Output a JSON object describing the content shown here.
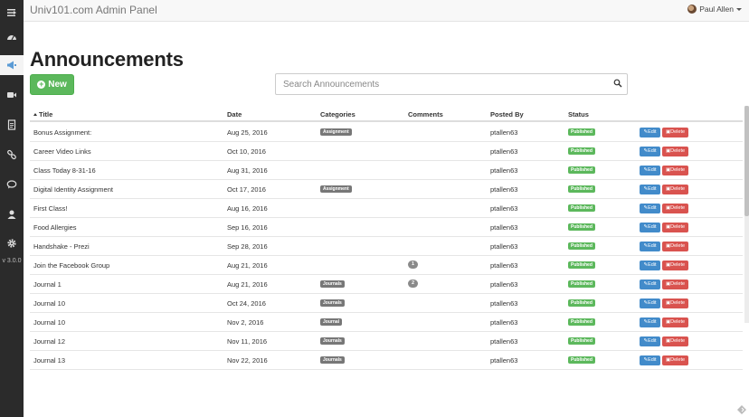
{
  "app": {
    "brand": "Univ101.com Admin Panel",
    "user_name": "Paul Allen"
  },
  "sidebar": {
    "items": [
      {
        "name": "menu-toggle-icon"
      },
      {
        "name": "dashboard-icon"
      },
      {
        "name": "announcements-icon",
        "active": true
      },
      {
        "name": "video-icon"
      },
      {
        "name": "document-icon"
      },
      {
        "name": "link-icon"
      },
      {
        "name": "chat-icon"
      },
      {
        "name": "user-icon"
      },
      {
        "name": "gear-icon"
      }
    ],
    "version": "v 3.0.0"
  },
  "page": {
    "title": "Announcements",
    "new_button_label": "New"
  },
  "search": {
    "placeholder": "Search Announcements",
    "value": ""
  },
  "table": {
    "columns": [
      "Title",
      "Date",
      "Categories",
      "Comments",
      "Posted By",
      "Status"
    ],
    "rows": [
      {
        "title": "Bonus Assignment:",
        "date": "Aug 25, 2016",
        "category": "Assignment",
        "comments": "",
        "posted_by": "ptallen63",
        "status": "Published"
      },
      {
        "title": "Career Video Links",
        "date": "Oct 10, 2016",
        "category": "",
        "comments": "",
        "posted_by": "ptallen63",
        "status": "Published"
      },
      {
        "title": "Class Today 8-31-16",
        "date": "Aug 31, 2016",
        "category": "",
        "comments": "",
        "posted_by": "ptallen63",
        "status": "Published"
      },
      {
        "title": "Digital Identity Assignment",
        "date": "Oct 17, 2016",
        "category": "Assignment",
        "comments": "",
        "posted_by": "ptallen63",
        "status": "Published"
      },
      {
        "title": "First Class!",
        "date": "Aug 16, 2016",
        "category": "",
        "comments": "",
        "posted_by": "ptallen63",
        "status": "Published"
      },
      {
        "title": "Food Allergies",
        "date": "Sep 16, 2016",
        "category": "",
        "comments": "",
        "posted_by": "ptallen63",
        "status": "Published"
      },
      {
        "title": "Handshake - Prezi",
        "date": "Sep 28, 2016",
        "category": "",
        "comments": "",
        "posted_by": "ptallen63",
        "status": "Published"
      },
      {
        "title": "Join the Facebook Group",
        "date": "Aug 21, 2016",
        "category": "",
        "comments": "1",
        "posted_by": "ptallen63",
        "status": "Published"
      },
      {
        "title": "Journal 1",
        "date": "Aug 21, 2016",
        "category": "Journals",
        "comments": "2",
        "posted_by": "ptallen63",
        "status": "Published"
      },
      {
        "title": "Journal 10",
        "date": "Oct 24, 2016",
        "category": "Journals",
        "comments": "",
        "posted_by": "ptallen63",
        "status": "Published"
      },
      {
        "title": "Journal 10",
        "date": "Nov 2, 2016",
        "category": "Journal",
        "comments": "",
        "posted_by": "ptallen63",
        "status": "Published"
      },
      {
        "title": "Journal 12",
        "date": "Nov 11, 2016",
        "category": "Journals",
        "comments": "",
        "posted_by": "ptallen63",
        "status": "Published"
      },
      {
        "title": "Journal 13",
        "date": "Nov 22, 2016",
        "category": "Journals",
        "comments": "",
        "posted_by": "ptallen63",
        "status": "Published"
      }
    ],
    "edit_label": "Edit",
    "delete_label": "Delete"
  },
  "colors": {
    "sidebar": "#2b2b2b",
    "success": "#5cb85c",
    "primary": "#428bca",
    "danger": "#d9534f",
    "label_default": "#777777"
  }
}
